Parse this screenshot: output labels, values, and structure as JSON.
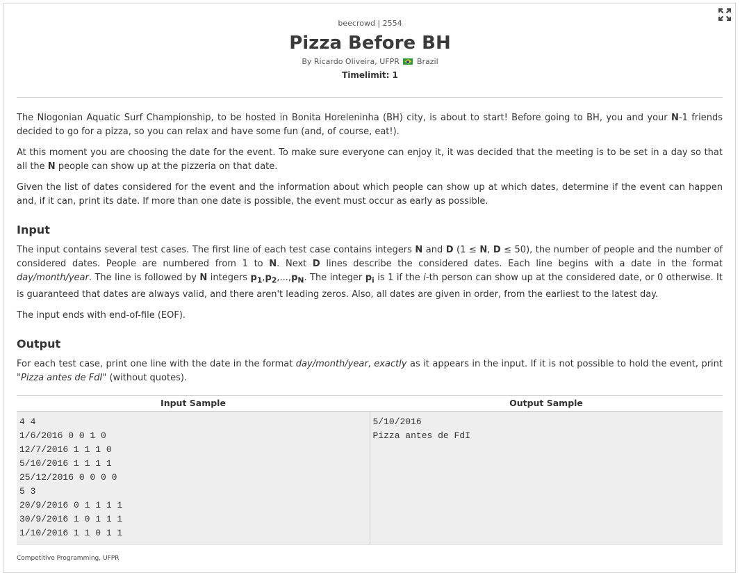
{
  "header": {
    "source": "beecrowd | 2554",
    "title": "Pizza Before BH",
    "author_prefix": "By Ricardo Oliveira, UFPR",
    "country": "Brazil",
    "timelimit": "Timelimit: 1"
  },
  "description": {
    "p1_a": "The Nlogonian Aquatic Surf Championship, to be hosted in Bonita Horeleninha (BH) city, is about to start! Before going to BH, you and your ",
    "p1_b": "N",
    "p1_c": "-1 friends decided to go for a pizza, so you can relax and have some fun (and, of course, eat!).",
    "p2_a": "At this moment you are choosing the date for the event. To make sure everyone can enjoy it, it was decided that the meeting is to be set in a day so that all the ",
    "p2_b": "N",
    "p2_c": " people can show up at the pizzeria on that date.",
    "p3": "Given the list of dates considered for the event and the information about which people can show up at which dates, determine if the event can happen and, if it can, print its date. If more than one date is possible, the event must occur as early as possible."
  },
  "input": {
    "heading": "Input",
    "t1": "The input contains several test cases. The first line of each test case contains integers ",
    "n1": "N",
    "t2": " and ",
    "d1": "D",
    "t3": " (1 ≤ ",
    "n2": "N",
    "t4": ", ",
    "d2": "D",
    "t5": " ≤ 50), the number of people and the number of considered dates. People are numbered from 1 to ",
    "n3": "N",
    "t6": ". Next ",
    "d3": "D",
    "t7": " lines describe the considered dates. Each line begins with a date in the format ",
    "fmt": "day/month/year",
    "t8": ". The line is followed by ",
    "n4": "N",
    "t9": " integers ",
    "p1": "p",
    "p1_sub": "1",
    "comma1": ",",
    "p2": "p",
    "p2_sub": "2",
    "dots": ",...,",
    "pn": "p",
    "pn_sub": "N",
    "t10": ". The integer ",
    "pi": "p",
    "pi_sub": "i",
    "t11": " is 1 if the ",
    "i_italic": "i",
    "t12": "-th person can show up at the considered date, or 0 otherwise. It is guaranteed that dates are always valid, and there aren't leading zeros. Also, all dates are given in order, from the earliest to the latest day.",
    "eof": "The input ends with end-of-file (EOF)."
  },
  "output": {
    "heading": "Output",
    "t1": "For each test case, print one line with the date in the format ",
    "fmt": "day/month/year",
    "t2": ", ",
    "exactly": "exactly",
    "t3": " as it appears in the input. If it is not possible to hold the event, print \"",
    "pizza": "Pizza antes de FdI",
    "t4": "\" (without quotes)."
  },
  "samples": {
    "input_label": "Input Sample",
    "output_label": "Output Sample",
    "input_text": "4 4\n1/6/2016 0 0 1 0\n12/7/2016 1 1 1 0\n5/10/2016 1 1 1 1\n25/12/2016 0 0 0 0\n5 3\n20/9/2016 0 1 1 1 1\n30/9/2016 1 0 1 1 1\n1/10/2016 1 1 0 1 1",
    "output_text": "5/10/2016\nPizza antes de FdI"
  },
  "footer": {
    "text": "Competitive Programming, UFPR"
  },
  "icons": {
    "expand": "expand-icon",
    "flag": "brazil-flag-icon"
  }
}
